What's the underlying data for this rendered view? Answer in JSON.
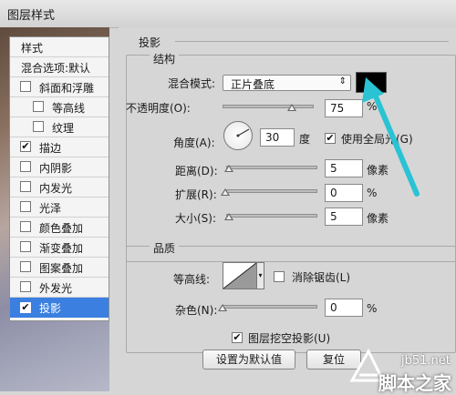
{
  "window": {
    "title": "图层样式"
  },
  "sidebar": {
    "header": "样式",
    "blend_options": "混合选项:默认",
    "items": [
      {
        "label": "斜面和浮雕",
        "checked": false,
        "indent": false
      },
      {
        "label": "等高线",
        "checked": false,
        "indent": true
      },
      {
        "label": "纹理",
        "checked": false,
        "indent": true
      },
      {
        "label": "描边",
        "checked": true,
        "indent": false
      },
      {
        "label": "内阴影",
        "checked": false,
        "indent": false
      },
      {
        "label": "内发光",
        "checked": false,
        "indent": false
      },
      {
        "label": "光泽",
        "checked": false,
        "indent": false
      },
      {
        "label": "颜色叠加",
        "checked": false,
        "indent": false
      },
      {
        "label": "渐变叠加",
        "checked": false,
        "indent": false
      },
      {
        "label": "图案叠加",
        "checked": false,
        "indent": false
      },
      {
        "label": "外发光",
        "checked": false,
        "indent": false
      },
      {
        "label": "投影",
        "checked": true,
        "indent": false,
        "selected": true
      }
    ]
  },
  "panel": {
    "title": "投影",
    "structure": {
      "title": "结构",
      "blend_mode_label": "混合模式:",
      "blend_mode_value": "正片叠底",
      "swatch_color": "#000000",
      "opacity_label": "不透明度(O):",
      "opacity_value": "75",
      "opacity_unit": "%",
      "angle_label": "角度(A):",
      "angle_value": "30",
      "angle_unit": "度",
      "global_light_label": "使用全局光(G)",
      "global_light_checked": true,
      "distance_label": "距离(D):",
      "distance_value": "5",
      "distance_unit": "像素",
      "spread_label": "扩展(R):",
      "spread_value": "0",
      "spread_unit": "%",
      "size_label": "大小(S):",
      "size_value": "5",
      "size_unit": "像素"
    },
    "quality": {
      "title": "品质",
      "contour_label": "等高线:",
      "antialias_label": "消除锯齿(L)",
      "antialias_checked": false,
      "noise_label": "杂色(N):",
      "noise_value": "0",
      "noise_unit": "%"
    },
    "knockout_label": "图层挖空投影(U)",
    "knockout_checked": true,
    "default_button": "设置为默认值",
    "reset_button": "复位"
  },
  "watermark": {
    "line1": "jb51.net",
    "line2": "脚本之家"
  },
  "colors": {
    "selection": "#3b7fe0",
    "arrow": "#29c3d4"
  }
}
